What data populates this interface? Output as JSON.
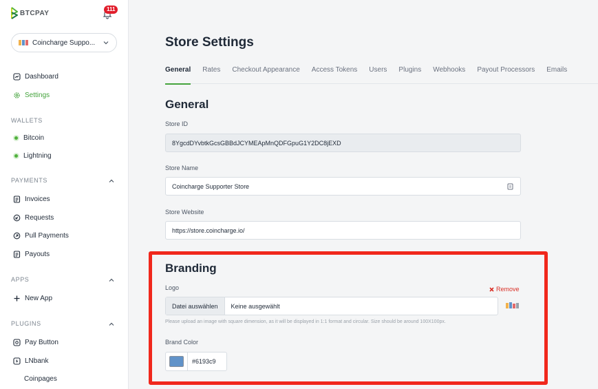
{
  "brand": {
    "logo_text": "BTCPAY",
    "notification_count": "111",
    "accent": "#44a33c"
  },
  "store_selector": {
    "name": "Coincharge Suppo..."
  },
  "nav": {
    "dashboard": "Dashboard",
    "settings": "Settings",
    "wallets_title": "WALLETS",
    "bitcoin": "Bitcoin",
    "lightning": "Lightning",
    "payments_title": "PAYMENTS",
    "invoices": "Invoices",
    "requests": "Requests",
    "pull_payments": "Pull Payments",
    "payouts": "Payouts",
    "apps_title": "APPS",
    "new_app": "New App",
    "plugins_title": "PLUGINS",
    "pay_button": "Pay Button",
    "lnbank": "LNbank",
    "coinpages": "Coinpages"
  },
  "page": {
    "title": "Store Settings",
    "tabs": [
      "General",
      "Rates",
      "Checkout Appearance",
      "Access Tokens",
      "Users",
      "Plugins",
      "Webhooks",
      "Payout Processors",
      "Emails"
    ]
  },
  "general": {
    "heading": "General",
    "store_id_label": "Store ID",
    "store_id_value": "8YgcdDYvbtkGcsGBBdJCYMEApMnQDFGpuG1Y2DC8jEXD",
    "store_name_label": "Store Name",
    "store_name_value": "Coincharge Supporter Store",
    "store_website_label": "Store Website",
    "store_website_value": "https://store.coincharge.io/"
  },
  "branding": {
    "heading": "Branding",
    "logo_label": "Logo",
    "remove_label": "Remove",
    "file_button": "Datei auswählen",
    "file_status": "Keine ausgewählt",
    "help_text": "Please upload an image with square dimension, as it will be displayed in 1:1 format and circular. Size should be around 100X100px.",
    "brand_color_label": "Brand Color",
    "brand_color_value": "#6193c9"
  }
}
